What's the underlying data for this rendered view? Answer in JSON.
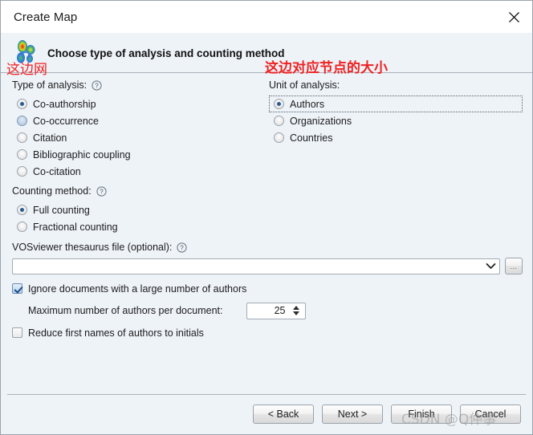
{
  "window": {
    "title": "Create Map",
    "close_icon": "close-icon"
  },
  "header": {
    "icon": "vosviewer-density-icon",
    "title": "Choose type of analysis and counting method"
  },
  "analysis": {
    "label": "Type of analysis:",
    "help_icon": "help-icon",
    "options": [
      {
        "label": "Co-authorship",
        "selected": true,
        "hover": false
      },
      {
        "label": "Co-occurrence",
        "selected": false,
        "hover": true
      },
      {
        "label": "Citation",
        "selected": false,
        "hover": false
      },
      {
        "label": "Bibliographic coupling",
        "selected": false,
        "hover": false
      },
      {
        "label": "Co-citation",
        "selected": false,
        "hover": false
      }
    ]
  },
  "unit": {
    "label": "Unit of analysis:",
    "options": [
      {
        "label": "Authors",
        "selected": true,
        "focused": true
      },
      {
        "label": "Organizations",
        "selected": false,
        "focused": false
      },
      {
        "label": "Countries",
        "selected": false,
        "focused": false
      }
    ]
  },
  "counting": {
    "label": "Counting method:",
    "help_icon": "help-icon",
    "options": [
      {
        "label": "Full counting",
        "selected": true
      },
      {
        "label": "Fractional counting",
        "selected": false
      }
    ]
  },
  "thesaurus": {
    "label": "VOSviewer thesaurus file (optional):",
    "help_icon": "help-icon",
    "value": "",
    "dropdown_icon": "chevron-down-icon",
    "browse_label": "..."
  },
  "options": {
    "ignore_large": {
      "label": "Ignore documents with a large number of authors",
      "checked": true
    },
    "max_authors": {
      "label": "Maximum number of authors per document:",
      "value": "25",
      "spinner_icon": "spinner-arrows-icon"
    },
    "reduce_initials": {
      "label": "Reduce first names of authors to initials",
      "checked": false
    }
  },
  "footer": {
    "back_label": "< Back",
    "next_label": "Next >",
    "finish_label": "Finish",
    "cancel_label": "Cancel"
  },
  "annotations": {
    "left": "这边网",
    "right": "这边对应节点的大小"
  },
  "watermark": {
    "text": "CSDN @Q仲事"
  },
  "colors": {
    "dialog_bg": "#eef3f8",
    "titlebar_bg": "#ffffff",
    "accent_blue": "#2b5c91",
    "annotation_red": "#ee2222",
    "separator": "#a9b2bb"
  }
}
